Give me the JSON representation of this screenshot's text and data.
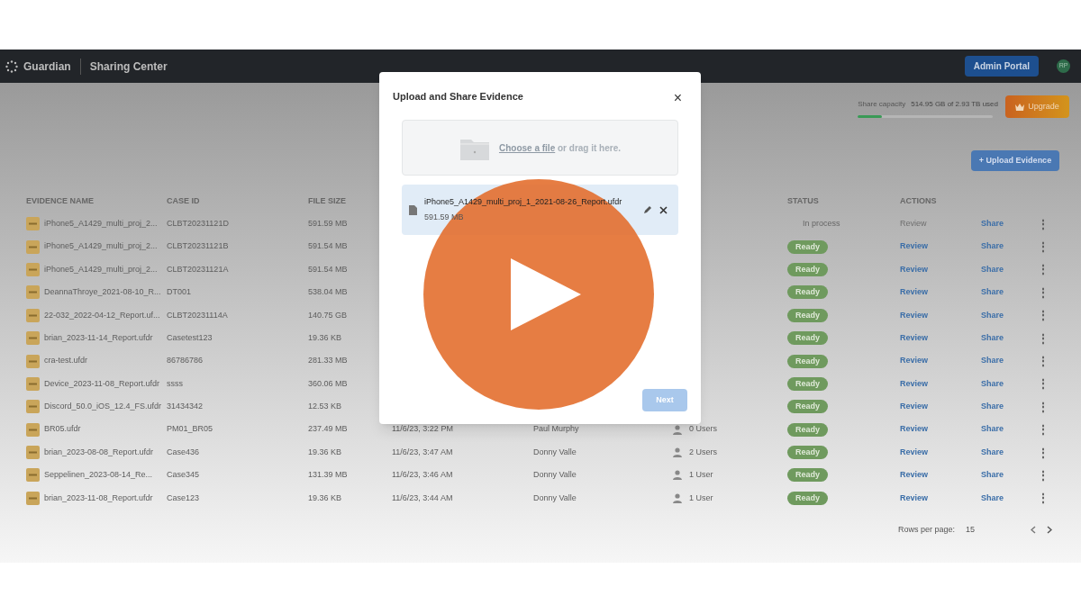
{
  "app_bar": {
    "brand": "Guardian",
    "section": "Sharing Center",
    "admin_button": "Admin Portal",
    "avatar": "RP"
  },
  "capacity": {
    "label": "Share capacity",
    "reading": "514.95 GB of 2.93 TB used",
    "level": 0.18,
    "upgrade_button": "Upgrade"
  },
  "upload_button": "+ Upload Evidence",
  "table": {
    "columns": [
      "EVIDENCE NAME",
      "CASE ID",
      "FILE SIZE",
      "STATUS",
      "ACTIONS"
    ],
    "rows": [
      {
        "name": "iPhone5_A1429_multi_proj_2...",
        "case_id": "CLBT20231121D",
        "size": "591.59 MB",
        "status": {
          "kind": "text",
          "label": "In process"
        },
        "review": {
          "label": "Review",
          "disabled": true
        },
        "share": "Share",
        "menu": "⋮"
      },
      {
        "name": "iPhone5_A1429_multi_proj_2...",
        "case_id": "CLBT20231121B",
        "size": "591.54 MB",
        "status": {
          "kind": "pill",
          "label": "Ready"
        },
        "review": {
          "label": "Review",
          "disabled": false
        },
        "share": "Share",
        "menu": "⋮"
      },
      {
        "name": "iPhone5_A1429_multi_proj_2...",
        "case_id": "CLBT20231121A",
        "size": "591.54 MB",
        "status": {
          "kind": "pill",
          "label": "Ready"
        },
        "review": {
          "label": "Review",
          "disabled": false
        },
        "share": "Share",
        "menu": "⋮"
      },
      {
        "name": "DeannaThroye_2021-08-10_R...",
        "case_id": "DT001",
        "size": "538.04 MB",
        "status": {
          "kind": "pill",
          "label": "Ready"
        },
        "review": {
          "label": "Review",
          "disabled": false
        },
        "share": "Share",
        "menu": "⋮"
      },
      {
        "name": "22-032_2022-04-12_Report.uf...",
        "case_id": "CLBT20231114A",
        "size": "140.75 GB",
        "status": {
          "kind": "pill",
          "label": "Ready"
        },
        "review": {
          "label": "Review",
          "disabled": false
        },
        "share": "Share",
        "menu": "⋮"
      },
      {
        "name": "brian_2023-11-14_Report.ufdr",
        "case_id": "Casetest123",
        "size": "19.36 KB",
        "status": {
          "kind": "pill",
          "label": "Ready"
        },
        "review": {
          "label": "Review",
          "disabled": false
        },
        "share": "Share",
        "menu": "⋮"
      },
      {
        "name": "cra-test.ufdr",
        "case_id": "86786786",
        "size": "281.33 MB",
        "status": {
          "kind": "pill",
          "label": "Ready"
        },
        "review": {
          "label": "Review",
          "disabled": false
        },
        "share": "Share",
        "menu": "⋮"
      },
      {
        "name": "Device_2023-11-08_Report.ufdr",
        "case_id": "ssss",
        "size": "360.06 MB",
        "status": {
          "kind": "pill",
          "label": "Ready"
        },
        "review": {
          "label": "Review",
          "disabled": false
        },
        "share": "Share",
        "menu": "⋮"
      },
      {
        "name": "Discord_50.0_iOS_12.4_FS.ufdr",
        "case_id": "31434342",
        "size": "12.53 KB",
        "status": {
          "kind": "pill",
          "label": "Ready"
        },
        "review": {
          "label": "Review",
          "disabled": false
        },
        "share": "Share",
        "menu": "⋮"
      },
      {
        "name": "BR05.ufdr",
        "case_id": "PM01_BR05",
        "size": "237.49 MB",
        "date": "11/6/23, 3:22 PM",
        "owner": "Paul Murphy",
        "sharing": "0 Users",
        "status": {
          "kind": "pill",
          "label": "Ready"
        },
        "review": {
          "label": "Review",
          "disabled": false
        },
        "share": "Share",
        "menu": "⋮"
      },
      {
        "name": "brian_2023-08-08_Report.ufdr",
        "case_id": "Case436",
        "size": "19.36 KB",
        "date": "11/6/23, 3:47 AM",
        "owner": "Donny Valle",
        "sharing": "2 Users",
        "status": {
          "kind": "pill",
          "label": "Ready"
        },
        "review": {
          "label": "Review",
          "disabled": false
        },
        "share": "Share",
        "menu": "⋮"
      },
      {
        "name": "Seppelinen_2023-08-14_Re...",
        "case_id": "Case345",
        "size": "131.39 MB",
        "date": "11/6/23, 3:46 AM",
        "owner": "Donny Valle",
        "sharing": "1 User",
        "status": {
          "kind": "pill",
          "label": "Ready"
        },
        "review": {
          "label": "Review",
          "disabled": false
        },
        "share": "Share",
        "menu": "⋮"
      },
      {
        "name": "brian_2023-11-08_Report.ufdr",
        "case_id": "Case123",
        "size": "19.36 KB",
        "date": "11/6/23, 3:44 AM",
        "owner": "Donny Valle",
        "sharing": "1 User",
        "status": {
          "kind": "pill",
          "label": "Ready"
        },
        "review": {
          "label": "Review",
          "disabled": false
        },
        "share": "Share",
        "menu": "⋮"
      }
    ]
  },
  "pagination": {
    "label": "Rows per page:",
    "per_page": "15"
  },
  "dialog": {
    "title": "Upload and Share Evidence",
    "close": "×",
    "dropzone": {
      "link": "Choose a file",
      "text": "or drag it here."
    },
    "file": {
      "name": "iPhone5_A1429_multi_proj_1_2021-08-26_Report.ufdr",
      "size": "591.59 MB"
    },
    "next_button": {
      "label": "Next",
      "disabled": true
    }
  }
}
